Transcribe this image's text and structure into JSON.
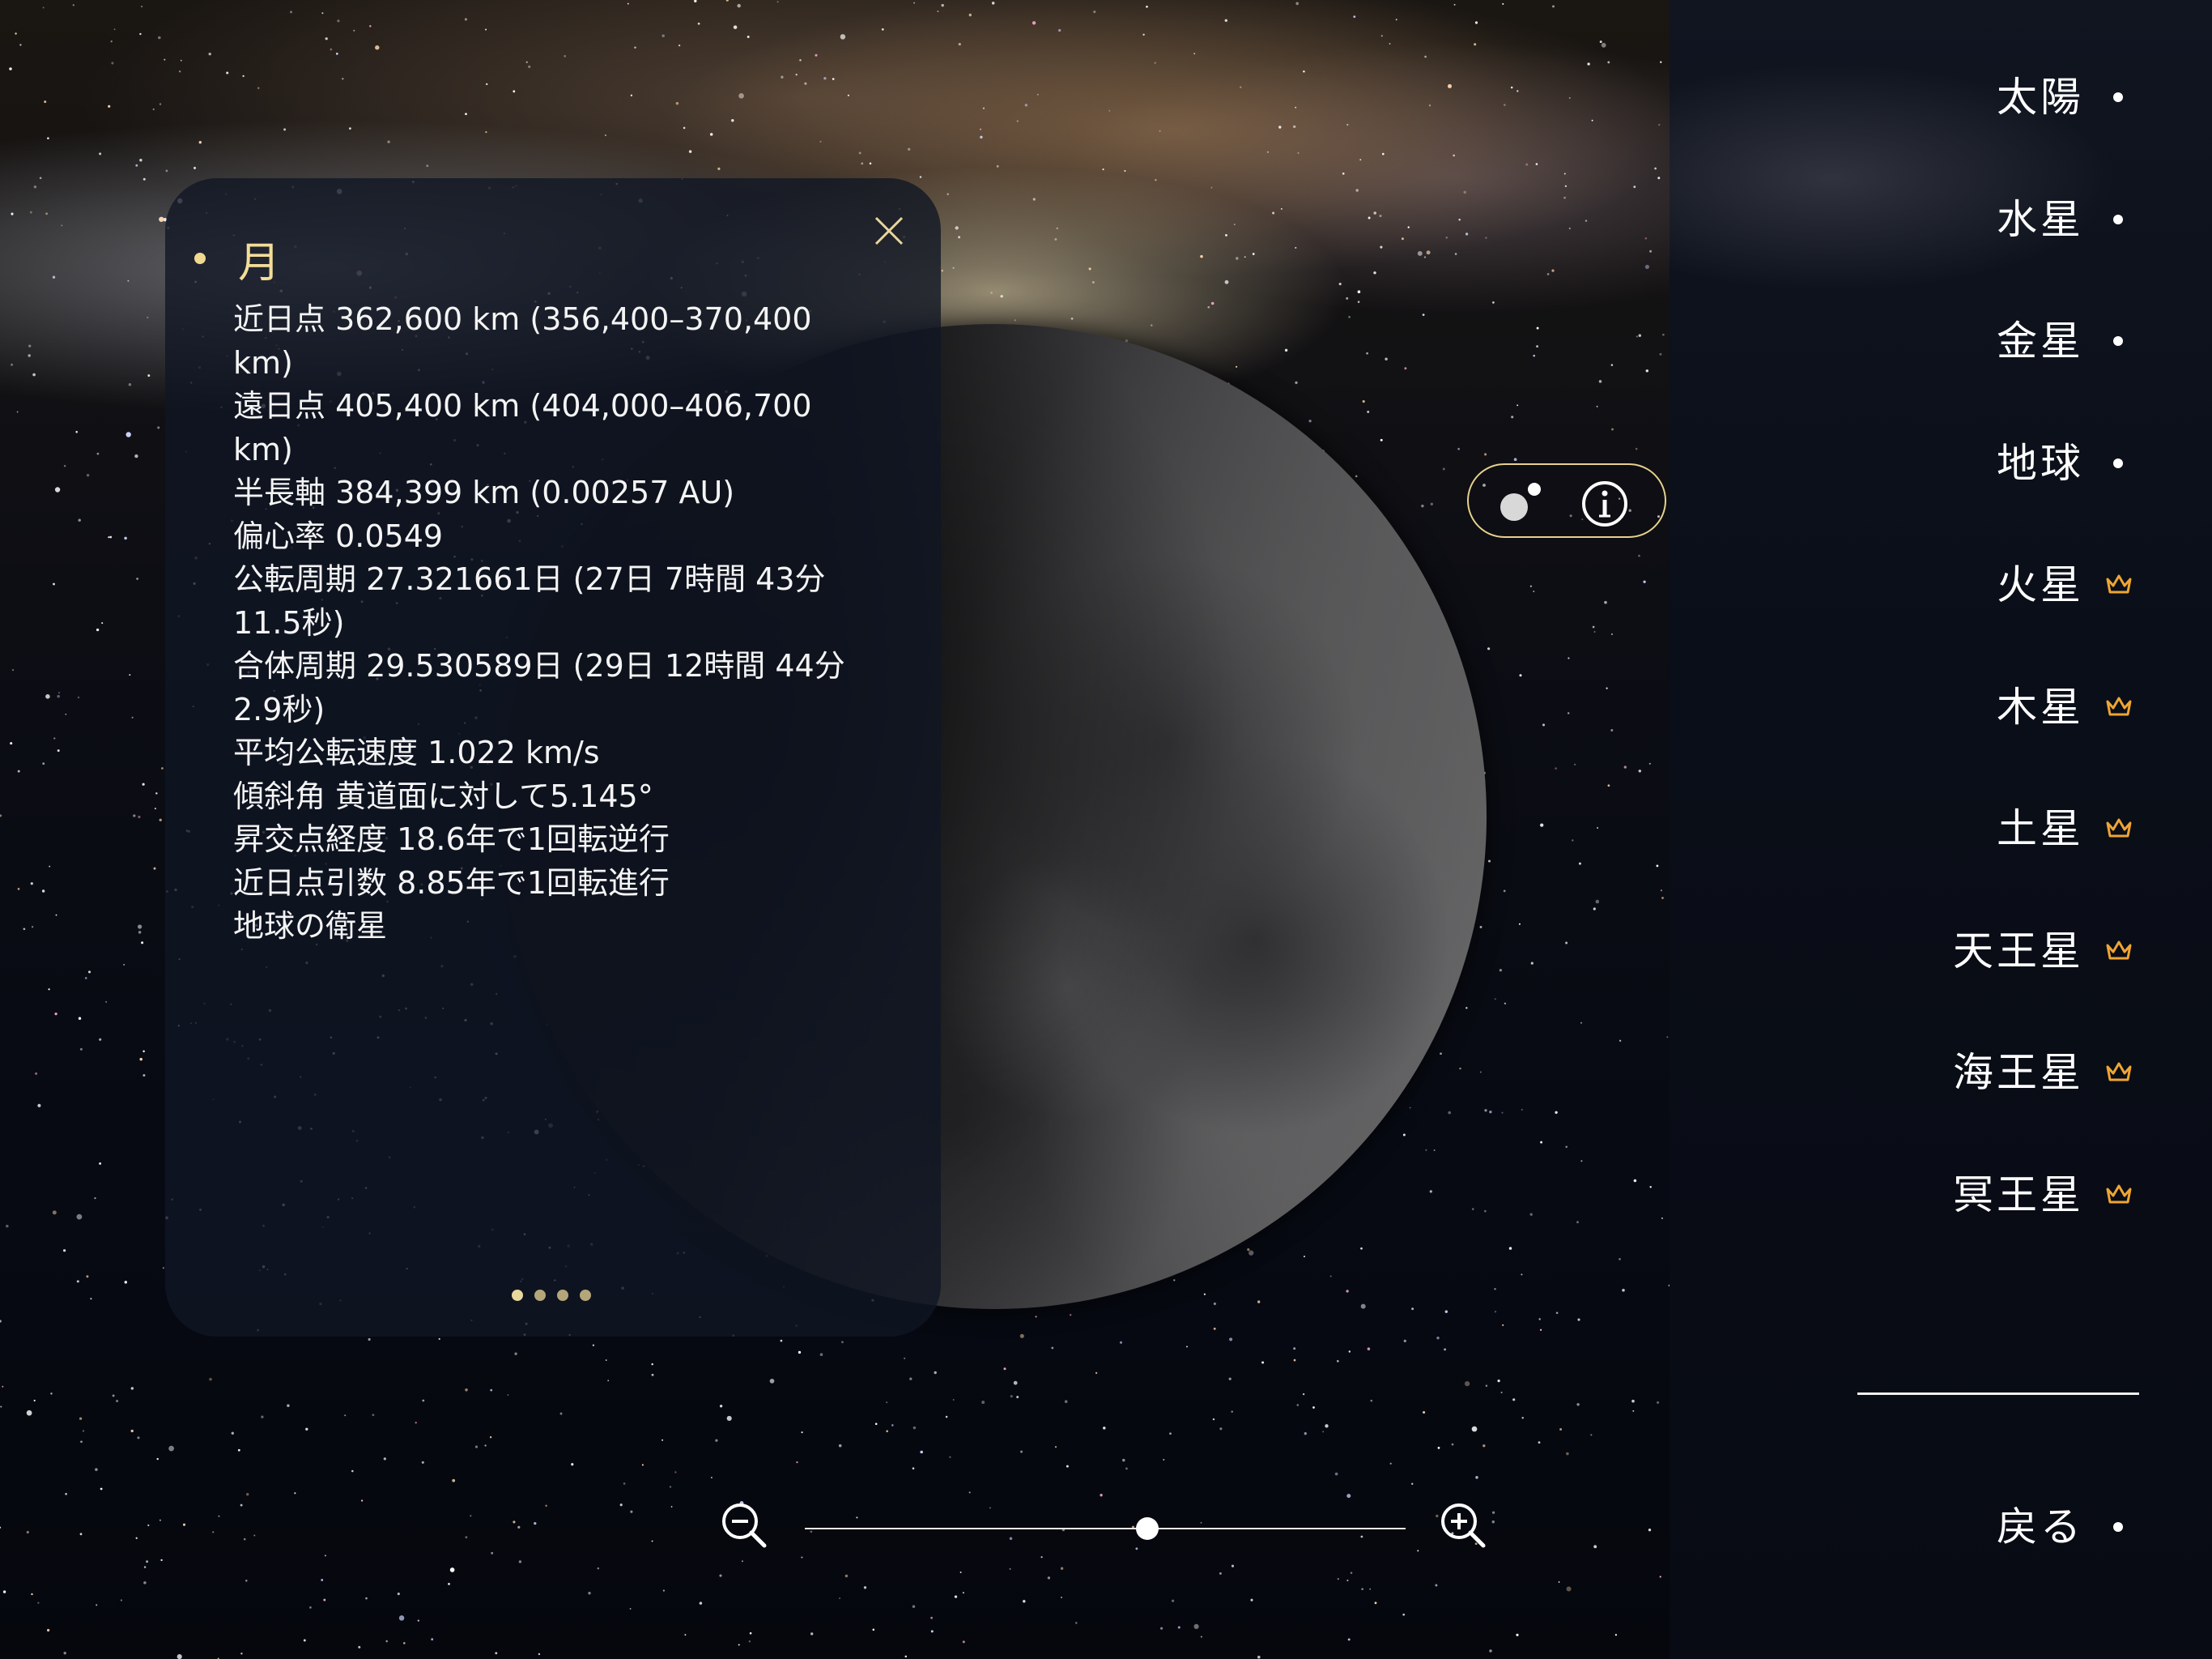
{
  "panel": {
    "title": "月",
    "lines": [
      "近日点 362,600 km (356,400–370,400 km)",
      "遠日点 405,400 km (404,000–406,700 km)",
      "半長軸 384,399 km (0.00257 AU)",
      "偏心率 0.0549",
      "公転周期 27.321661日 (27日 7時間 43分 11.5秒)",
      "合体周期 29.530589日 (29日 12時間 44分 2.9秒)",
      "平均公転速度 1.022 km/s",
      "傾斜角 黄道面に対して5.145°",
      "昇交点経度 18.6年で1回転逆行",
      "近日点引数 8.85年で1回転進行",
      "地球の衛星"
    ],
    "page_count": 4,
    "current_page": 1
  },
  "zoom": {
    "level": 0.57
  },
  "sidebar": {
    "items": [
      {
        "label": "太陽",
        "icon": "dot-icon"
      },
      {
        "label": "水星",
        "icon": "dot-icon"
      },
      {
        "label": "金星",
        "icon": "dot-icon"
      },
      {
        "label": "地球",
        "icon": "dot-icon"
      },
      {
        "label": "火星",
        "icon": "crown-icon"
      },
      {
        "label": "木星",
        "icon": "crown-icon"
      },
      {
        "label": "土星",
        "icon": "crown-icon"
      },
      {
        "label": "天王星",
        "icon": "crown-icon"
      },
      {
        "label": "海王星",
        "icon": "crown-icon"
      },
      {
        "label": "冥王星",
        "icon": "crown-icon"
      }
    ],
    "back_label": "戻る"
  },
  "colors": {
    "accent_gold": "#f3dd98",
    "crown_orange": "#f0a533",
    "panel_bg": "#101624"
  }
}
